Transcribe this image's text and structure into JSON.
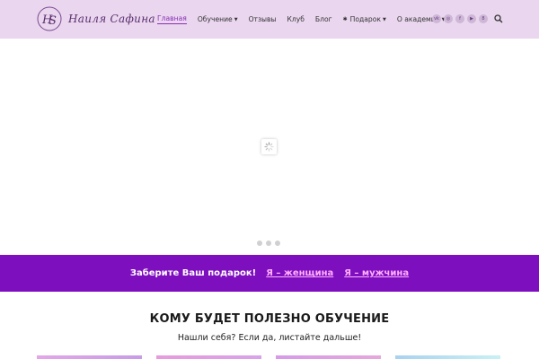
{
  "header": {
    "logo_text": "Наиля Сафина",
    "nav": [
      {
        "label": "Главная",
        "active": true,
        "dropdown": false
      },
      {
        "label": "Обучение",
        "active": false,
        "dropdown": true
      },
      {
        "label": "Отзывы",
        "active": false,
        "dropdown": false
      },
      {
        "label": "Клуб",
        "active": false,
        "dropdown": false
      },
      {
        "label": "Блог",
        "active": false,
        "dropdown": false
      },
      {
        "label": "Подарок",
        "active": false,
        "dropdown": true
      },
      {
        "label": "О академии",
        "active": false,
        "dropdown": true
      }
    ],
    "socials": [
      {
        "icon": "vk-icon",
        "glyph": "vk"
      },
      {
        "icon": "instagram-icon",
        "glyph": "◎"
      },
      {
        "icon": "facebook-icon",
        "glyph": "f"
      },
      {
        "icon": "youtube-icon",
        "glyph": "▶"
      },
      {
        "icon": "odnoklassniki-icon",
        "glyph": "8"
      }
    ],
    "search_icon": "search-icon"
  },
  "slider": {
    "state": "loading",
    "dots_count": 3
  },
  "gift_bar": {
    "text": "Заберите Ваш подарок!",
    "link_female": "Я – женщина",
    "link_male": "Я – мужчина",
    "bg_color": "#7e0fbf",
    "link_color": "#ffb0ff"
  },
  "section": {
    "title": "КОМУ БУДЕТ ПОЛЕЗНО ОБУЧЕНИЕ",
    "subtitle": "Нашли себя? Если да, листайте дальше!"
  },
  "colors": {
    "header_bg": "#ead6ef",
    "accent": "#8a2fb5"
  }
}
